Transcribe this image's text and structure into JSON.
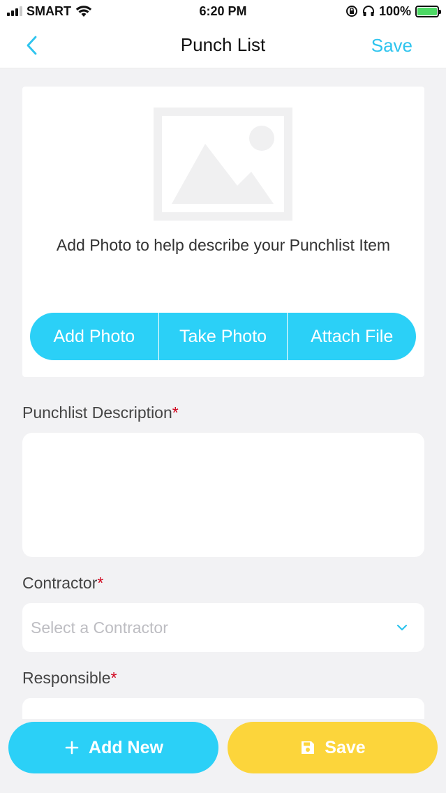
{
  "status_bar": {
    "carrier": "SMART",
    "time": "6:20 PM",
    "battery": "100%"
  },
  "nav": {
    "title": "Punch List",
    "save_label": "Save"
  },
  "photo_section": {
    "hint": "Add Photo to help describe your Punchlist Item",
    "actions": [
      "Add Photo",
      "Take Photo",
      "Attach File"
    ]
  },
  "form": {
    "description_label": "Punchlist Description",
    "description_value": "",
    "required_marker": "*",
    "contractor_label": "Contractor",
    "contractor_placeholder": "Select a Contractor",
    "responsible_label": "Responsible"
  },
  "footer": {
    "add_new_label": "Add New",
    "save_label": "Save"
  },
  "colors": {
    "accent": "#2bd0f7",
    "save_yellow": "#fcd53b",
    "required": "#d0021b",
    "background": "#f2f2f4"
  },
  "icons": {
    "back": "chevron-left-icon",
    "image_placeholder": "image-placeholder-icon",
    "dropdown": "chevron-down-icon",
    "add": "plus-icon",
    "save": "floppy-disk-icon"
  }
}
